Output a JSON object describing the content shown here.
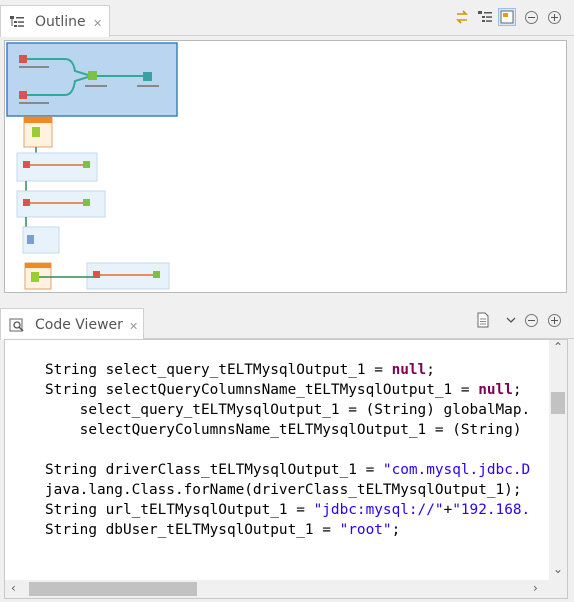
{
  "outline": {
    "tab_label": "Outline",
    "tab_close": "✕",
    "tools": [
      "sync-icon",
      "tree-view-icon",
      "overview-icon",
      "minimize-icon",
      "maximize-icon"
    ]
  },
  "code_viewer": {
    "tab_label": "Code Viewer",
    "tab_close": "✕",
    "tools": [
      "document-icon",
      "view-menu-icon",
      "minimize-icon",
      "maximize-icon"
    ],
    "lines": [
      "",
      "String select_query_tELTMysqlOutput_1 = null;",
      "String selectQueryColumnsName_tELTMysqlOutput_1 = null;",
      "    select_query_tELTMysqlOutput_1 = (String) globalMap.",
      "    selectQueryColumnsName_tELTMysqlOutput_1 = (String)",
      "",
      "String driverClass_tELTMysqlOutput_1 = \"com.mysql.jdbc.D",
      "java.lang.Class.forName(driverClass_tELTMysqlOutput_1);",
      "String url_tELTMysqlOutput_1 = \"jdbc:mysql://\"+\"192.168.",
      "String dbUser_tELTMysqlOutput_1 = \"root\";"
    ]
  }
}
